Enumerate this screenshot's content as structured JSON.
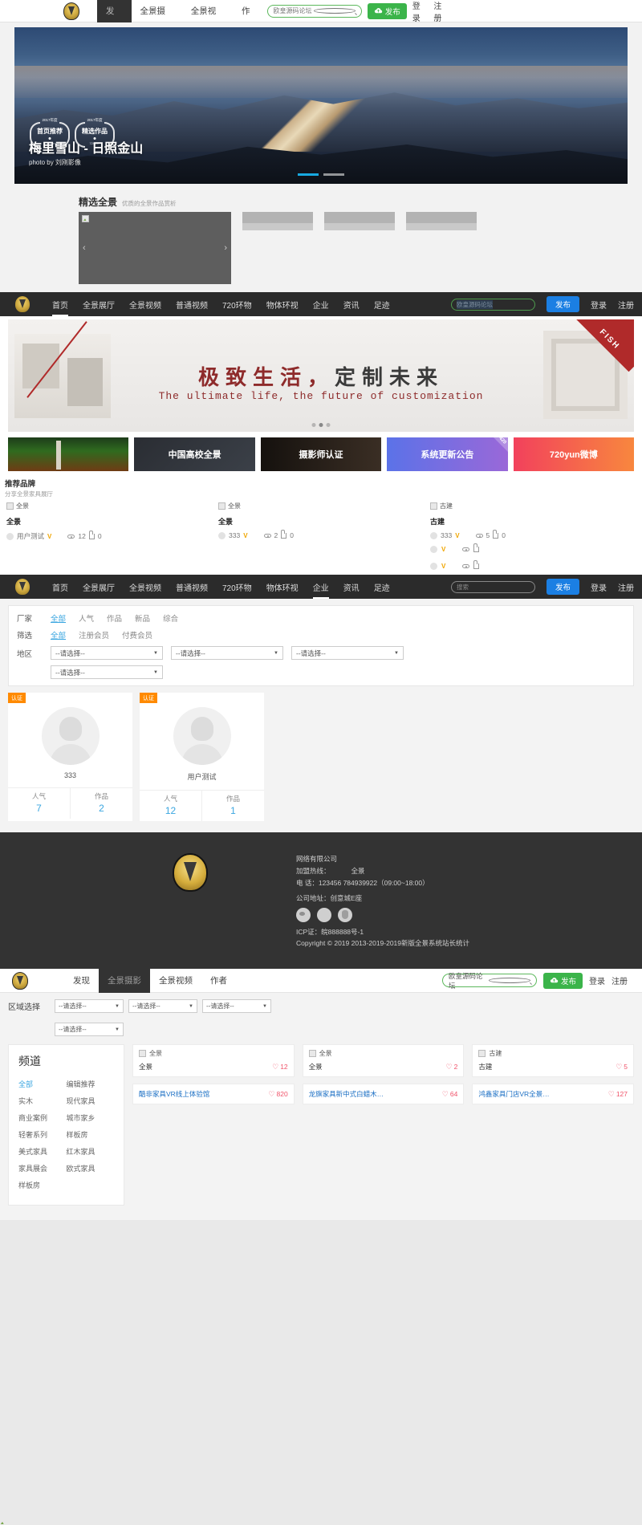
{
  "section1": {
    "nav": [
      {
        "label": "发现",
        "active": true
      },
      {
        "label": "全景摄影",
        "active": false
      },
      {
        "label": "全景视频",
        "active": false
      },
      {
        "label": "作者",
        "active": false
      }
    ],
    "search_placeholder": "欧皇源码论坛",
    "publish_label": "发布",
    "login_label": "登录",
    "register_label": "注册",
    "hero": {
      "award1_year": "2017年度",
      "award1_title": "首页推荐",
      "award1_sub": "720yun",
      "award2_year": "2017年度",
      "award2_title": "精选作品",
      "award2_sub": "720yun",
      "title": "梅里雪山 - 日照金山",
      "subtitle": "photo by 刘刚影像"
    },
    "featured": {
      "title": "精选全景",
      "subtitle": "优质的全景作品赏析"
    }
  },
  "section2": {
    "nav": [
      {
        "label": "首页",
        "active": true
      },
      {
        "label": "全景展厅",
        "active": false
      },
      {
        "label": "全景视频",
        "active": false
      },
      {
        "label": "普通视频",
        "active": false
      },
      {
        "label": "720环物",
        "active": false
      },
      {
        "label": "物体环视",
        "active": false
      },
      {
        "label": "企业",
        "active": false
      },
      {
        "label": "资讯",
        "active": false
      },
      {
        "label": "足迹",
        "active": false
      }
    ],
    "search_placeholder": "欧皇源码论坛",
    "publish_label": "发布",
    "login_label": "登录",
    "register_label": "注册",
    "banner": {
      "corner_text": "FISH",
      "headline_red": "极致生活，",
      "headline_dark": "定制未来",
      "subhead": "The ultimate life, the future of customization"
    },
    "cards": [
      {
        "label": "",
        "style": "rocket",
        "corner": ""
      },
      {
        "label": "中国高校全景",
        "style": "uni",
        "corner": ""
      },
      {
        "label": "摄影师认证",
        "style": "cam",
        "corner": ""
      },
      {
        "label": "系统更新公告",
        "style": "sys",
        "corner": "420"
      },
      {
        "label": "720yun微博",
        "style": "wb",
        "corner": ""
      }
    ],
    "brand": {
      "title": "推荐品牌",
      "subtitle": "分享全景家具展厅"
    },
    "items": [
      {
        "img_alt": "全景",
        "name": "全景",
        "author": "用户测试",
        "views": "12",
        "likes": "0"
      },
      {
        "img_alt": "全景",
        "name": "全景",
        "author": "333",
        "views": "2",
        "likes": "0"
      },
      {
        "img_alt": "古建",
        "name": "古建",
        "author": "333",
        "views": "5",
        "likes": "0"
      }
    ]
  },
  "section3": {
    "nav": [
      {
        "label": "首页",
        "active": false
      },
      {
        "label": "全景展厅",
        "active": false
      },
      {
        "label": "全景视频",
        "active": false
      },
      {
        "label": "普通视频",
        "active": false
      },
      {
        "label": "720环物",
        "active": false
      },
      {
        "label": "物体环视",
        "active": false
      },
      {
        "label": "企业",
        "active": true
      },
      {
        "label": "资讯",
        "active": false
      },
      {
        "label": "足迹",
        "active": false
      }
    ],
    "search_placeholder": "搜索",
    "publish_label": "发布",
    "login_label": "登录",
    "register_label": "注册",
    "filters": {
      "row1_label": "厂家",
      "row1_options": [
        "全部",
        "人气",
        "作品",
        "新品",
        "综合"
      ],
      "row1_active": "全部",
      "row2_label": "筛选",
      "row2_options": [
        "全部",
        "注册会员",
        "付费会员"
      ],
      "row2_active": "全部",
      "row3_label": "地区",
      "select_placeholder": "--请选择--"
    },
    "users": [
      {
        "badge": "认证",
        "name": "333",
        "stat1_label": "人气",
        "stat1_value": "7",
        "stat2_label": "作品",
        "stat2_value": "2"
      },
      {
        "badge": "认证",
        "name": "用户测试",
        "stat1_label": "人气",
        "stat1_value": "12",
        "stat2_label": "作品",
        "stat2_value": "1"
      }
    ]
  },
  "footer": {
    "company": "网络有限公司",
    "hotline_label": "加盟热线：",
    "hotline_value": "全景",
    "phone": "电 话：123456 784939922（09:00~18:00）",
    "address": "公司地址：创意城E座",
    "icp": "ICP证：皖888888号-1",
    "copyright": "Copyright © 2019 2013-2019-2019新版全景系统站长统计"
  },
  "section4": {
    "nav": [
      {
        "label": "发现",
        "active": false
      },
      {
        "label": "全景摄影",
        "active": true
      },
      {
        "label": "全景视频",
        "active": false
      },
      {
        "label": "作者",
        "active": false
      }
    ],
    "search_placeholder": "欧皇源码论坛",
    "publish_label": "发布",
    "login_label": "登录",
    "register_label": "注册",
    "area_label": "区域选择",
    "select_placeholder": "--请选择--",
    "channel": {
      "title": "频道",
      "items": [
        {
          "label": "全部",
          "on": true
        },
        {
          "label": "编辑推荐",
          "on": false
        },
        {
          "label": "实木",
          "on": false
        },
        {
          "label": "现代家具",
          "on": false
        },
        {
          "label": "商业案例",
          "on": false
        },
        {
          "label": "城市家乡",
          "on": false
        },
        {
          "label": "轻奢系列",
          "on": false
        },
        {
          "label": "样板房",
          "on": false
        },
        {
          "label": "美式家具",
          "on": false
        },
        {
          "label": "红木家具",
          "on": false
        },
        {
          "label": "家具展会",
          "on": false
        },
        {
          "label": "欧式家具",
          "on": false
        },
        {
          "label": "样板房",
          "on": false
        }
      ]
    },
    "products": [
      {
        "img_alt": "全景",
        "title": "全景",
        "count": "12",
        "sub_title": "酷非家具VR线上体验馆",
        "sub_count": "820"
      },
      {
        "img_alt": "全景",
        "title": "全景",
        "count": "2",
        "sub_title": "龙旗家具新中式白蜡木…",
        "sub_count": "64"
      },
      {
        "img_alt": "古建",
        "title": "古建",
        "count": "5",
        "sub_title": "鸿鑫家具门店VR全景…",
        "sub_count": "127"
      }
    ]
  }
}
